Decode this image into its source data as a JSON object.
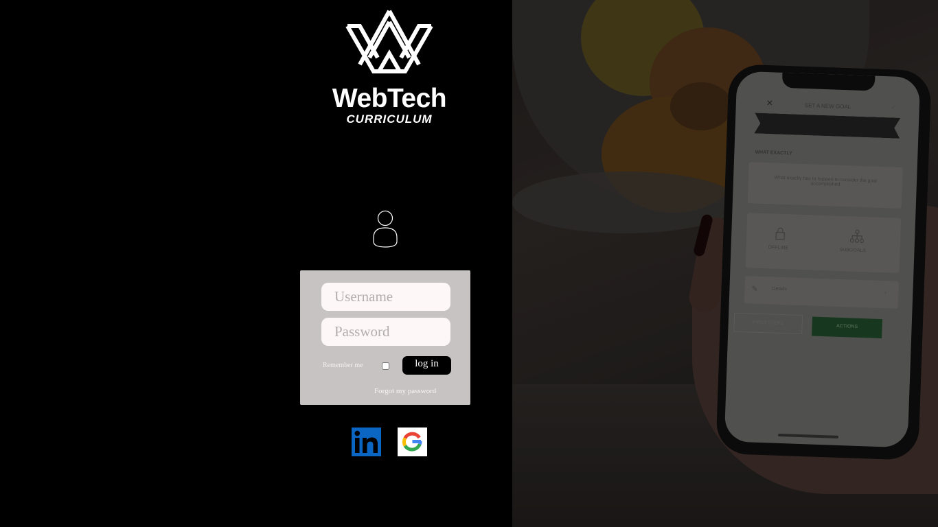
{
  "brand": {
    "logo_icon": "crown-logo-icon",
    "title": "WebTech",
    "subtitle": "CURRICULUM"
  },
  "login": {
    "avatar_icon": "user-icon",
    "username_placeholder": "Username",
    "username_value": "",
    "password_placeholder": "Password",
    "password_value": "",
    "remember_label": "Remember me",
    "remember_checked": false,
    "login_label": "log in",
    "forgot_label": "Forgot my password"
  },
  "social": [
    {
      "name": "LinkedIn",
      "icon": "linkedin-icon"
    },
    {
      "name": "Google",
      "icon": "google-icon"
    }
  ],
  "background_phone": {
    "heading": "SET A NEW GOAL",
    "section": "WHAT EXACTLY",
    "placeholder": "What exactly has to happen to consider the goal accomplished",
    "offline": "OFFLINE",
    "subgoals": "SUBGOALS",
    "details": "Details",
    "secondary_button": "FIRST STEPS",
    "actions_button": "ACTIONS"
  },
  "colors": {
    "card_background": "#c7c3c2",
    "input_background": "#fdf8f7",
    "login_button": "#000000",
    "linkedin": "#0a66c2"
  }
}
